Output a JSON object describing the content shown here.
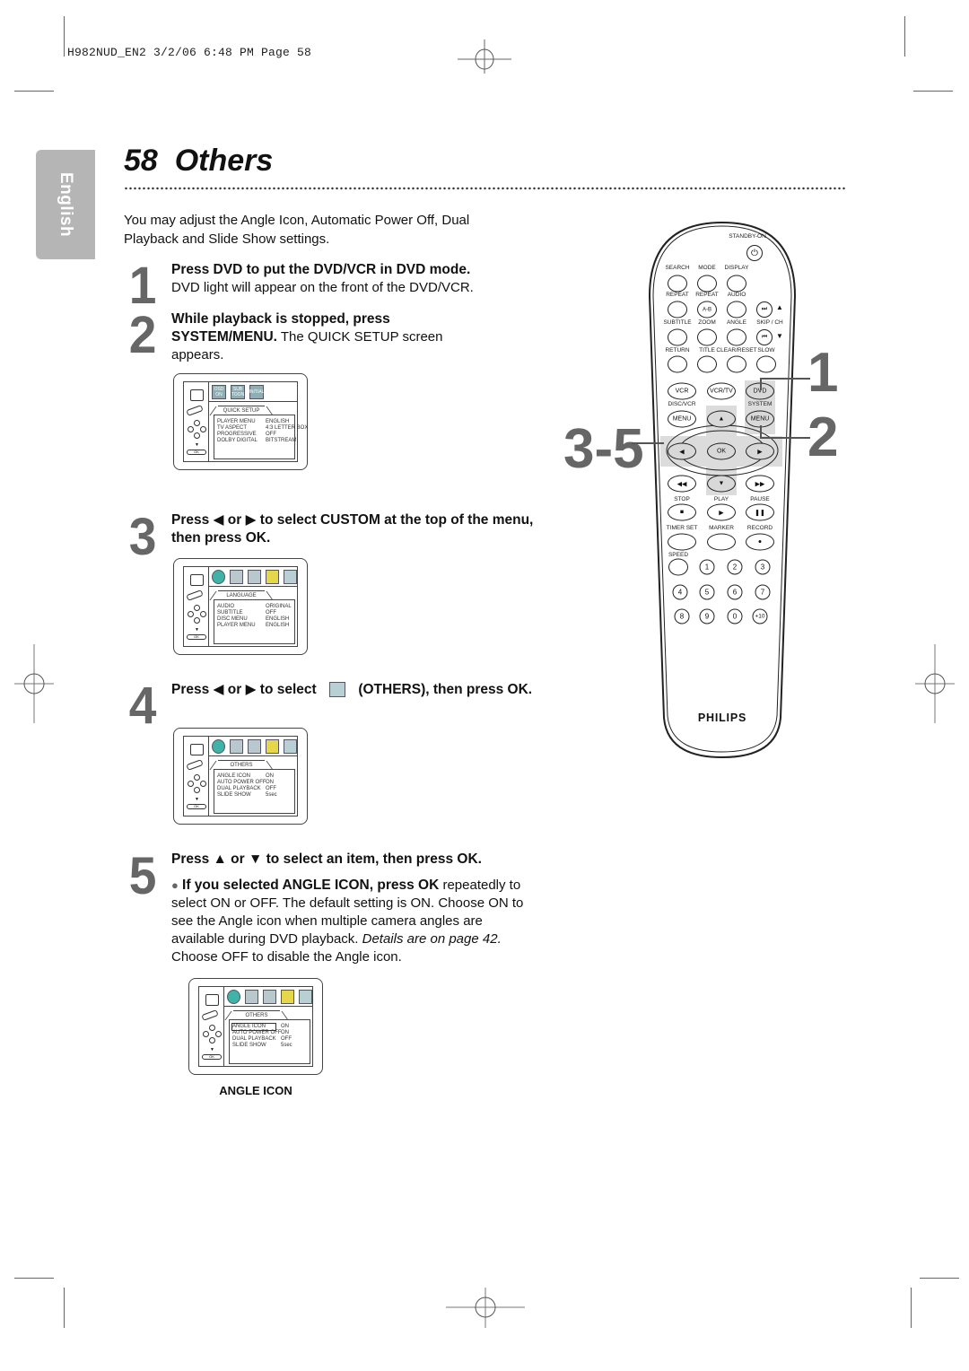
{
  "slug": "H982NUD_EN2  3/2/06  6:48 PM  Page 58",
  "language_tab": "English",
  "page_title": "58  Others",
  "intro": "You may adjust the Angle Icon, Automatic Power Off, Dual Playback and Slide Show settings.",
  "steps": [
    {
      "num": "1",
      "bold": "Press DVD to put the DVD/VCR in DVD mode.",
      "text": "DVD light will appear on the front of the DVD/VCR."
    },
    {
      "num": "2",
      "bold": "While playback is stopped, press SYSTEM/MENU.",
      "text": " The QUICK SETUP screen appears."
    },
    {
      "num": "3",
      "bold": "Press ◀ or ▶ to select CUSTOM at the top of the menu, then press OK.",
      "text": ""
    },
    {
      "num": "4",
      "bold_a": "Press ◀ or ▶ to select",
      "bold_b": "(OTHERS), then press OK.",
      "icon": "others-icon"
    },
    {
      "num": "5",
      "bold": "Press ▲ or ▼ to select an item, then press OK.",
      "bullet_bold": "If you selected ANGLE ICON, press OK",
      "bullet_text": " repeatedly to select ON or OFF. The default setting is ON. Choose ON to see the Angle icon when multiple camera angles are available during DVD playback. ",
      "bullet_italic": "Details are on page 42.",
      "bullet_tail": " Choose OFF to disable the Angle icon."
    }
  ],
  "screens": {
    "quick_setup": {
      "tabs": [
        "OSD ON",
        "SUB TOON",
        "INITIAL"
      ],
      "tab_label": "QUICK SETUP",
      "rows": [
        [
          "PLAYER MENU",
          "ENGLISH"
        ],
        [
          "TV ASPECT",
          "4:3 LETTER BOX"
        ],
        [
          "PROGRESSIVE",
          "OFF"
        ],
        [
          "DOLBY DIGITAL",
          "BITSTREAM"
        ]
      ]
    },
    "language": {
      "tab_label": "LANGUAGE",
      "rows": [
        [
          "AUDIO",
          "ORIGINAL"
        ],
        [
          "SUBTITLE",
          "OFF"
        ],
        [
          "DISC MENU",
          "ENGLISH"
        ],
        [
          "PLAYER MENU",
          "ENGLISH"
        ]
      ]
    },
    "others": {
      "tab_label": "OTHERS",
      "rows": [
        [
          "ANGLE ICON",
          "ON"
        ],
        [
          "AUTO POWER OFF",
          "ON"
        ],
        [
          "DUAL PLAYBACK",
          "OFF"
        ],
        [
          "SLIDE SHOW",
          "5sec"
        ]
      ]
    },
    "angle_icon": {
      "tab_label": "OTHERS",
      "rows": [
        [
          "ANGLE ICON",
          "ON"
        ],
        [
          "AUTO POWER OFF",
          "ON"
        ],
        [
          "DUAL PLAYBACK",
          "OFF"
        ],
        [
          "SLIDE SHOW",
          "5sec"
        ]
      ],
      "caption": "ANGLE ICON"
    },
    "ok_label": "OK"
  },
  "remote": {
    "standby": "STANDBY-ON",
    "labels_row1": [
      "SEARCH",
      "MODE",
      "DISPLAY"
    ],
    "labels_row2": [
      "REPEAT",
      "REPEAT",
      "AUDIO"
    ],
    "ab": "A-B",
    "labels_row3": [
      "SUBTITLE",
      "ZOOM",
      "ANGLE",
      "SKIP / CH"
    ],
    "labels_row4": [
      "RETURN",
      "TITLE",
      "CLEAR/RESET",
      "SLOW"
    ],
    "vcr": "VCR",
    "vcrtv": "VCR/TV",
    "dvd": "DVD",
    "disc_vcr": "DISC/VCR",
    "system": "SYSTEM",
    "menu": "MENU",
    "ok": "OK",
    "stop": "STOP",
    "play": "PLAY",
    "pause": "PAUSE",
    "timer_set": "TIMER SET",
    "marker": "MARKER",
    "record": "RECORD",
    "speed": "SPEED",
    "numbers": [
      "1",
      "2",
      "3",
      "4",
      "5",
      "6",
      "7",
      "8",
      "9",
      "0",
      "+10"
    ],
    "brand": "PHILIPS",
    "callouts": [
      "1",
      "2",
      "3-5"
    ]
  }
}
